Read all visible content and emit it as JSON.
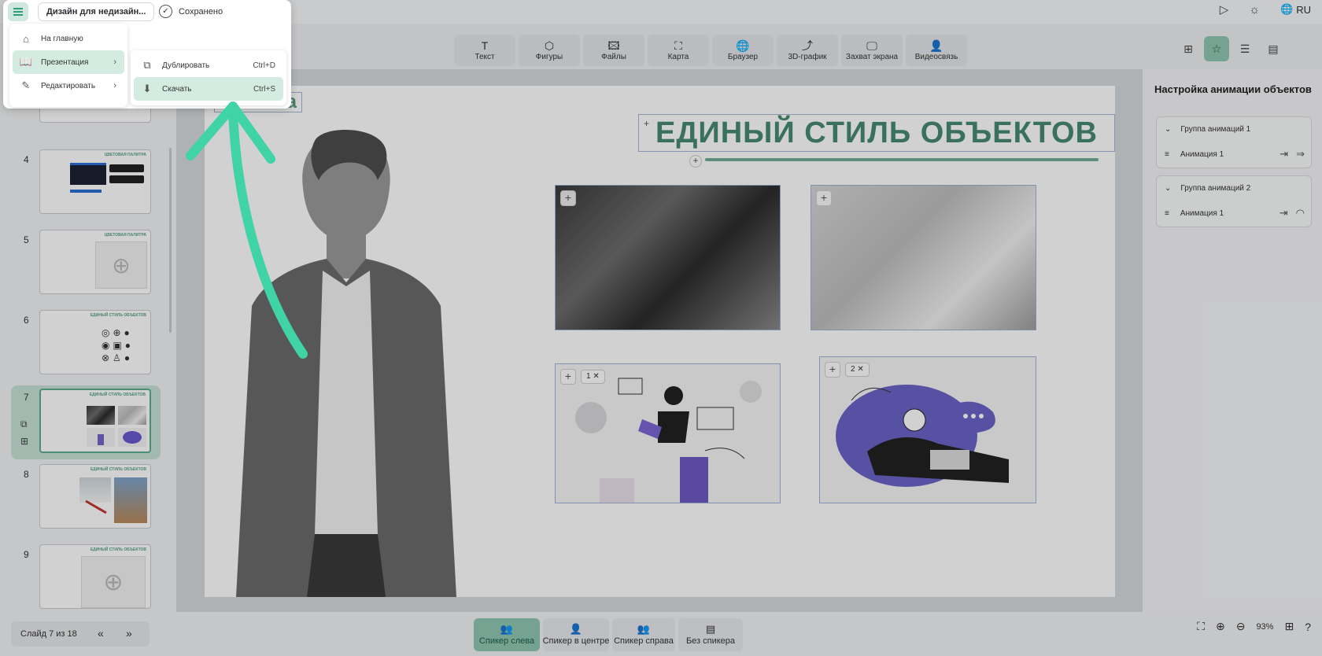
{
  "header": {
    "doc_title": "Дизайн для недизайн...",
    "saved_label": "Сохранено",
    "lang": "RU",
    "icons": {
      "play": "play-icon",
      "theme": "theme-toggle-icon",
      "globe": "globe-icon"
    }
  },
  "toolbar": {
    "tools": [
      {
        "label": "Текст",
        "icon": "T"
      },
      {
        "label": "Фигуры",
        "icon": "⬡"
      },
      {
        "label": "Файлы",
        "icon": "🖾"
      },
      {
        "label": "Карта",
        "icon": "⛶"
      },
      {
        "label": "Браузер",
        "icon": "🌐"
      },
      {
        "label": "3D-график",
        "icon": "⤴"
      },
      {
        "label": "Захват экрана",
        "icon": "🖵"
      },
      {
        "label": "Видеосвязь",
        "icon": "👤"
      }
    ]
  },
  "menu": {
    "items": [
      {
        "label": "На главную",
        "icon": "⌂"
      },
      {
        "label": "Презентация",
        "icon": "📖"
      },
      {
        "label": "Редактировать",
        "icon": "✎"
      }
    ],
    "submenu": [
      {
        "label": "Дублировать",
        "shortcut": "Ctrl+D",
        "icon": "⧉"
      },
      {
        "label": "Скачать",
        "shortcut": "Ctrl+S",
        "icon": "⬇"
      }
    ]
  },
  "sidebar": {
    "slides": [
      {
        "num": "4",
        "title": "ЦВЕТОВАЯ ПАЛИТРА"
      },
      {
        "num": "5",
        "title": "ЦВЕТОВАЯ ПАЛИТРА"
      },
      {
        "num": "6",
        "title": "ЕДИНЫЙ СТИЛЬ ОБЪЕКТОВ"
      },
      {
        "num": "7",
        "title": "ЕДИНЫЙ СТИЛЬ ОБЪЕКТОВ"
      },
      {
        "num": "8",
        "title": "ЕДИНЫЙ СТИЛЬ ОБЪЕКТОВ"
      },
      {
        "num": "9",
        "title": "ЕДИНЫЙ СТИЛЬ ОБЪЕКТОВ"
      }
    ]
  },
  "slide": {
    "title": "ЕДИНЫЙ СТИЛЬ ОБЪЕКТОВ",
    "ghost_text": "а",
    "badges": [
      "1 ✕",
      "2 ✕"
    ]
  },
  "right_panel": {
    "title": "Настройка анимации объектов",
    "groups": [
      {
        "name": "Группа анимаций 1",
        "item": "Анимация 1"
      },
      {
        "name": "Группа анимаций 2",
        "item": "Анимация 1"
      }
    ]
  },
  "bottom": {
    "slide_counter": "Слайд 7 из 18",
    "prev": "«",
    "next": "»",
    "layouts": [
      {
        "label": "Спикер слева",
        "active": true
      },
      {
        "label": "Спикер в центре",
        "active": false
      },
      {
        "label": "Спикер справа",
        "active": false
      },
      {
        "label": "Без спикера",
        "active": false
      }
    ],
    "zoom": "93%"
  },
  "colors": {
    "accent": "#8fc6b1",
    "accent_dark": "#468a72",
    "arrow": "#3fd3a6"
  }
}
